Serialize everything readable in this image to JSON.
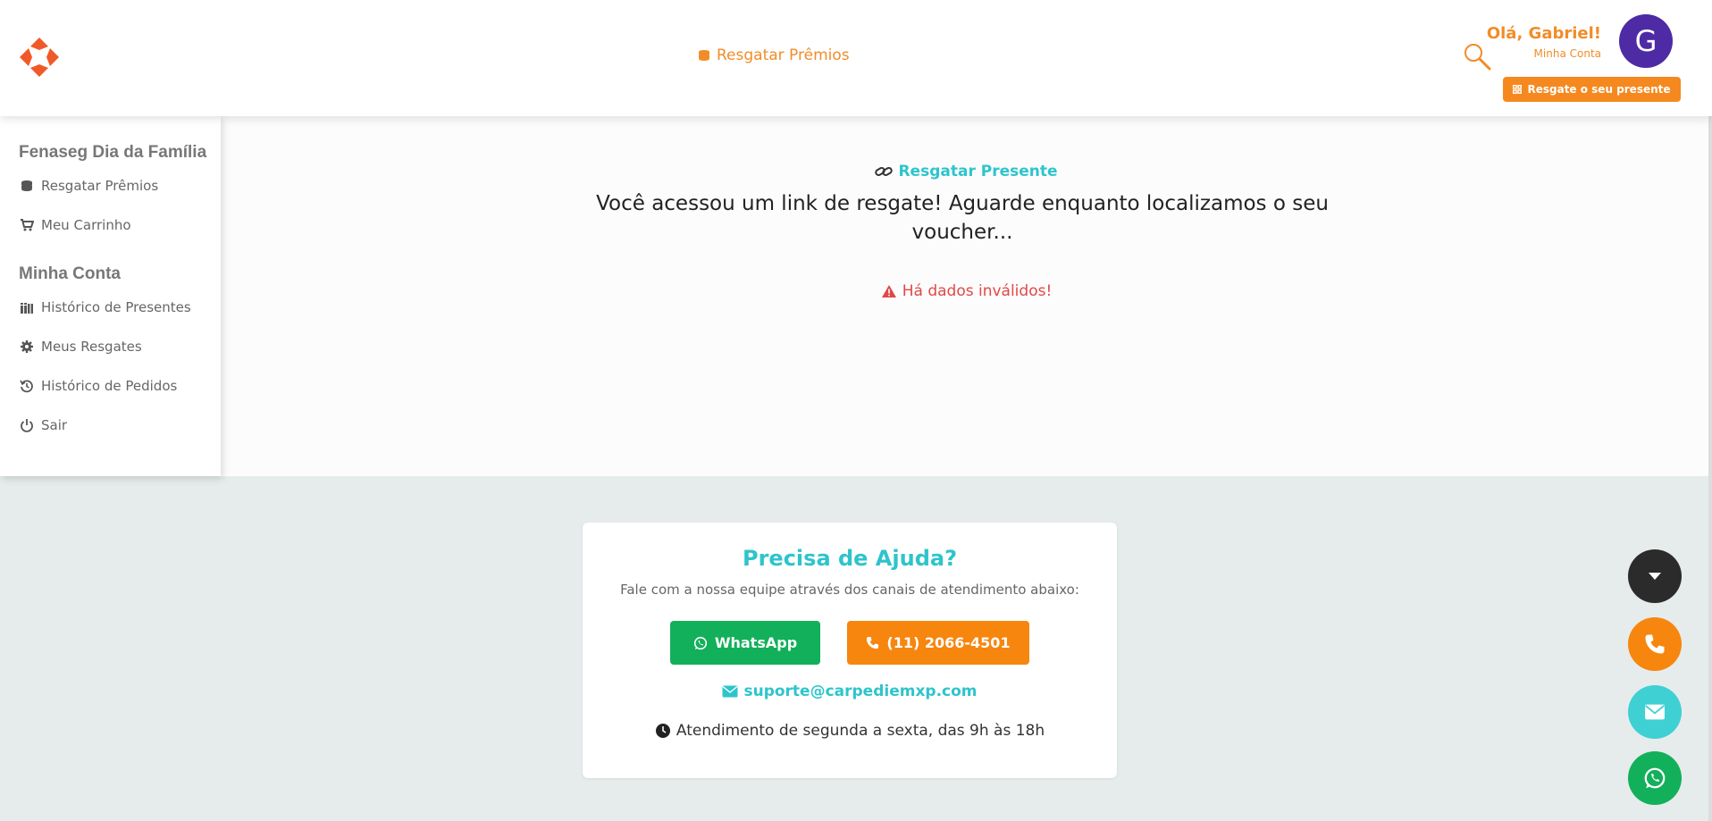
{
  "header": {
    "nav_link": "Resgatar Prêmios",
    "greeting": "Olá, Gabriel!",
    "account_link": "Minha Conta",
    "avatar_letter": "G",
    "redeem_button": "Resgate o seu presente"
  },
  "sidebar": {
    "section1_title": "Fenaseg Dia da Família",
    "section1_items": [
      {
        "label": "Resgatar Prêmios",
        "icon": "coins-icon"
      },
      {
        "label": "Meu Carrinho",
        "icon": "cart-icon"
      }
    ],
    "section2_title": "Minha Conta",
    "section2_items": [
      {
        "label": "Histórico de Presentes",
        "icon": "gifts-icon"
      },
      {
        "label": "Meus Resgates",
        "icon": "gear-icon"
      },
      {
        "label": "Histórico de Pedidos",
        "icon": "history-icon"
      },
      {
        "label": "Sair",
        "icon": "power-icon"
      }
    ]
  },
  "main": {
    "redeem_title": "Resgatar Presente",
    "redeem_message": "Você acessou um link de resgate! Aguarde enquanto localizamos o seu voucher...",
    "error_message": "Há dados inválidos!"
  },
  "help": {
    "title": "Precisa de Ajuda?",
    "subtitle": "Fale com a nossa equipe através dos canais de atendimento abaixo:",
    "whatsapp_label": "WhatsApp",
    "phone_label": "(11) 2066-4501",
    "email": "suporte@carpediemxp.com",
    "hours": "Atendimento de segunda a sexta, das 9h às 18h"
  },
  "colors": {
    "accent_orange": "#f28c28",
    "accent_teal": "#2ec4cc",
    "whatsapp_green": "#12b05a",
    "avatar_purple": "#4e2aa4",
    "error_red": "#e04848"
  }
}
